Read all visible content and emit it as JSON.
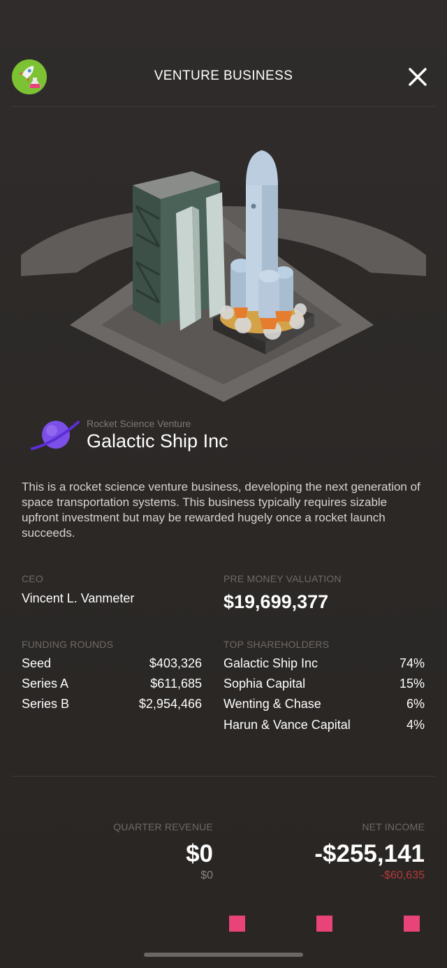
{
  "header": {
    "title": "VENTURE BUSINESS",
    "app_icon": "rocket-flask-icon",
    "close_icon": "close-icon"
  },
  "business": {
    "category": "Rocket Science Venture",
    "name": "Galactic Ship Inc",
    "description": "This is a rocket science venture business, developing the next generation of space transportation systems. This business typically requires sizable upfront investment but may be rewarded hugely once a rocket launch succeeds."
  },
  "ceo": {
    "label": "CEO",
    "value": "Vincent L. Vanmeter"
  },
  "valuation": {
    "label": "PRE MONEY VALUATION",
    "value": "$19,699,377"
  },
  "funding": {
    "label": "FUNDING ROUNDS",
    "rounds": [
      {
        "name": "Seed",
        "amount": "$403,326"
      },
      {
        "name": "Series A",
        "amount": "$611,685"
      },
      {
        "name": "Series B",
        "amount": "$2,954,466"
      }
    ]
  },
  "shareholders": {
    "label": "TOP SHAREHOLDERS",
    "items": [
      {
        "name": "Galactic Ship Inc",
        "pct": "74%"
      },
      {
        "name": "Sophia Capital",
        "pct": "15%"
      },
      {
        "name": "Wenting & Chase",
        "pct": "6%"
      },
      {
        "name": "Harun & Vance Capital",
        "pct": "4%"
      }
    ]
  },
  "financials": {
    "revenue_label": "QUARTER REVENUE",
    "revenue": "$0",
    "revenue_sub": "$0",
    "income_label": "NET INCOME",
    "income": "-$255,141",
    "income_sub": "-$60,635"
  },
  "colors": {
    "accent_pink": "#e8447a",
    "negative_red": "#b53a3a",
    "icon_green": "#7cc233"
  }
}
